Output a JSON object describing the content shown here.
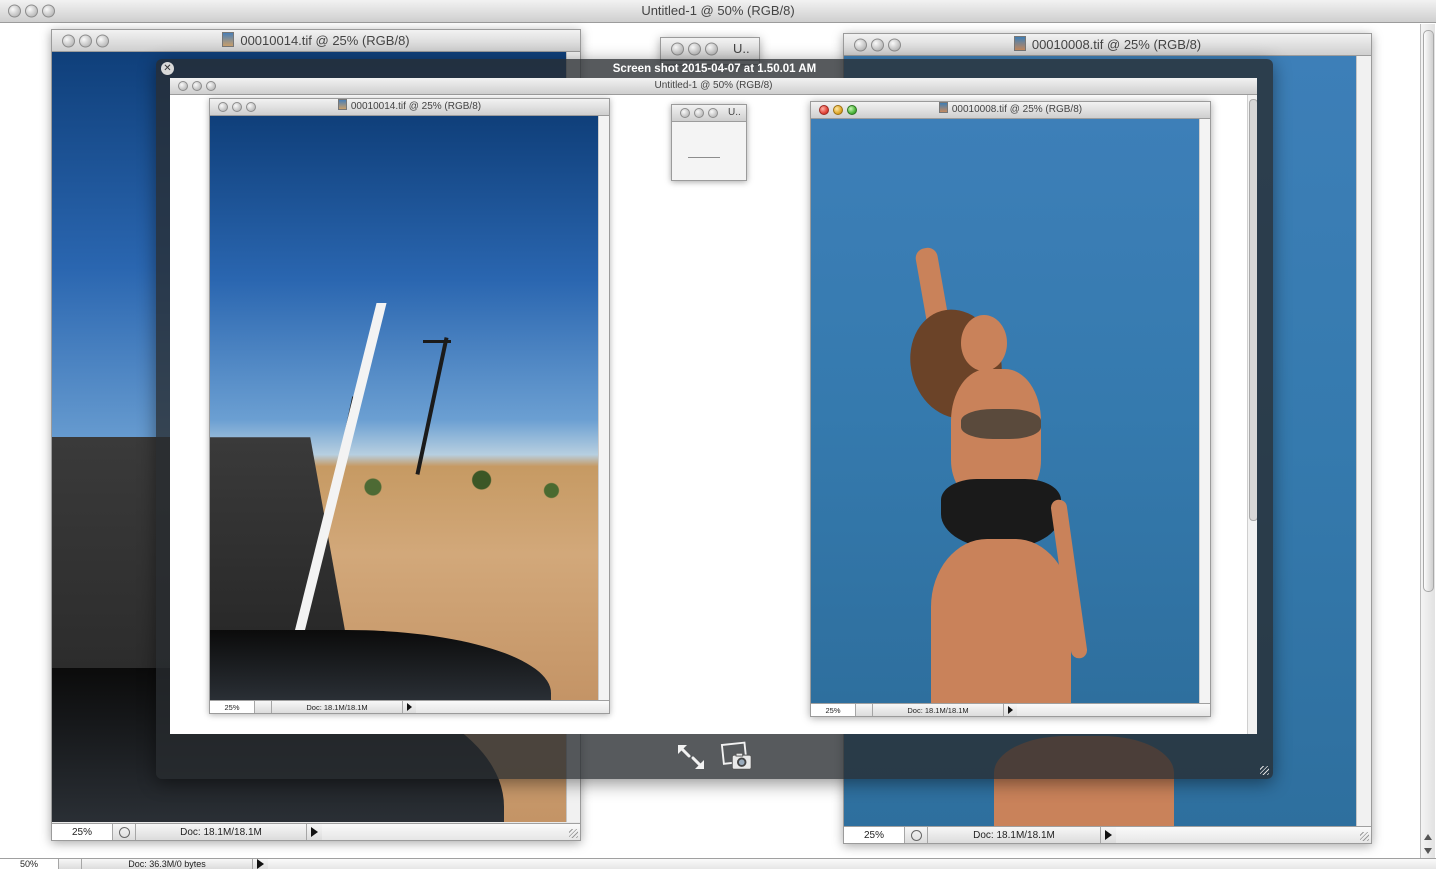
{
  "main_window": {
    "title": "Untitled-1 @ 50% (RGB/8)",
    "status": {
      "zoom": "50%",
      "doc": "Doc: 36.3M/0 bytes"
    }
  },
  "left_doc": {
    "title": "00010014.tif @ 25% (RGB/8)",
    "status": {
      "zoom": "25%",
      "doc": "Doc: 18.1M/18.1M"
    }
  },
  "small_window": {
    "title": "U.."
  },
  "right_doc": {
    "title": "00010008.tif @ 25% (RGB/8)",
    "status": {
      "zoom": "25%",
      "doc": "Doc: 18.1M/18.1M"
    }
  },
  "quicklook": {
    "title": "Screen shot 2015-04-07 at 1.50.01 AM",
    "inner": {
      "main_title": "Untitled-1 @ 50% (RGB/8)",
      "left_doc": {
        "title": "00010014.tif @ 25% (RGB/8)",
        "status": {
          "zoom": "25%",
          "doc": "Doc: 18.1M/18.1M"
        }
      },
      "small_window": {
        "title": "U.."
      },
      "right_doc": {
        "title": "00010008.tif @ 25% (RGB/8)",
        "status": {
          "zoom": "25%",
          "doc": "Doc: 18.1M/18.1M"
        }
      }
    },
    "buttons": {
      "fullscreen_icon": "expand-arrows-icon",
      "snapshot_icon": "camera-icon"
    }
  },
  "icons": {
    "close": "close-icon",
    "document": "document-icon",
    "grip": "resize-grip-icon"
  }
}
